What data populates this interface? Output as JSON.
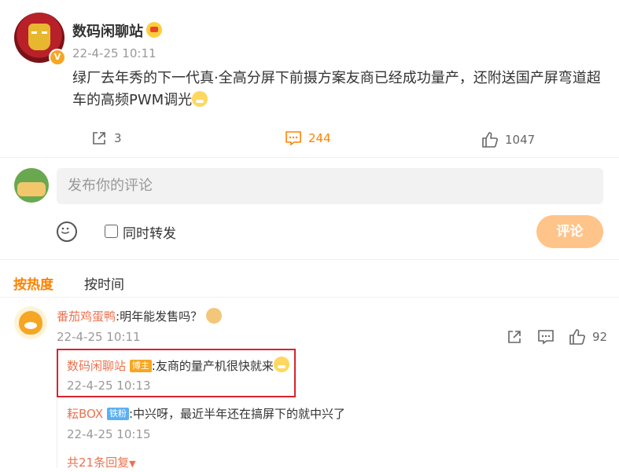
{
  "post": {
    "author": "数码闲聊站",
    "time": "22-4-25 10:11",
    "content": "绿厂去年秀的下一代真·全高分屏下前摄方案友商已经成功量产，还附送国产屏弯道超车的高频PWM调光",
    "v_badge": "V",
    "actions": {
      "repost": "3",
      "comment": "244",
      "like": "1047"
    }
  },
  "comment_box": {
    "placeholder": "发布你的评论",
    "repost_label": "同时转发",
    "submit_label": "评论"
  },
  "sort_tabs": {
    "hot": "按热度",
    "time": "按时间"
  },
  "comments": [
    {
      "name": "番茄鸡蛋鸭",
      "text": ":明年能发售吗？",
      "time": "22-4-25 10:11",
      "likes": "92",
      "replies": [
        {
          "name": "数码闲聊站",
          "tag": "博主",
          "text": ":友商的量产机很快就来",
          "time": "22-4-25 10:13"
        },
        {
          "name": "耘BOX",
          "tag": "铁粉",
          "text": ":中兴呀，最近半年还在搞屏下的就中兴了",
          "time": "22-4-25 10:15"
        }
      ],
      "more": "共21条回复"
    }
  ],
  "colors": {
    "accent": "#ff8200",
    "name": "#eb7350",
    "highlight_border": "#d9232d",
    "submit_bg": "#ffc48a"
  }
}
